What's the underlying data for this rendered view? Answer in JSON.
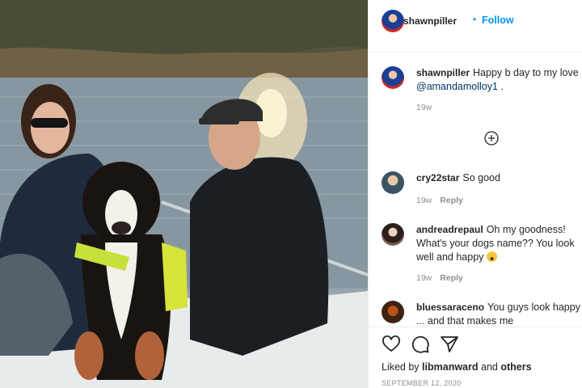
{
  "post": {
    "owner_username": "shawnpiller",
    "follow_separator": "•",
    "follow_label": "Follow"
  },
  "caption": {
    "username": "shawnpiller",
    "text": "Happy b day to my love",
    "mention": "@amandamolloy1",
    "suffix": ".",
    "time": "19w"
  },
  "comments": [
    {
      "username": "cry22star",
      "text": "So good",
      "time": "19w",
      "reply_label": "Reply"
    },
    {
      "username": "andreadrepaul",
      "text": "Oh my goodness! What's your dogs name?? You look well and happy",
      "emoji": "grinning-face",
      "time": "19w",
      "reply_label": "Reply"
    },
    {
      "username": "bluessaraceno",
      "text": "You guys look happy ... and that makes me"
    }
  ],
  "likes": {
    "prefix": "Liked by",
    "user": "libmanward",
    "and_label": "and",
    "others_label": "others"
  },
  "date": "SEPTEMBER 12, 2020",
  "icons": {
    "like": "heart-icon",
    "comment": "comment-bubble-icon",
    "share": "paper-plane-icon",
    "load_more": "plus-circle-icon"
  },
  "colors": {
    "link_blue": "#0095f6",
    "mention_blue": "#00376b",
    "muted_gray": "#8e8e8e",
    "text": "#262626"
  }
}
